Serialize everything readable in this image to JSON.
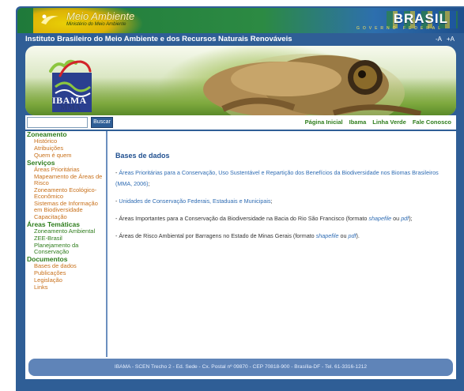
{
  "gov_bar": {
    "title": "Meio Ambiente",
    "subtitle": "Ministério do Meio Ambiente",
    "brasil": "BRASIL",
    "brasil_sub": "GOVERNO FEDERAL"
  },
  "institute": {
    "title": "Instituto Brasileiro do Meio Ambiente e dos Recursos Naturais Renováveis",
    "font_decrease": "-A",
    "font_increase": "+A"
  },
  "banner": {
    "logo_text": "IBAMA",
    "logo_sub": "MMA",
    "colors": {
      "green": "#2e7d1c",
      "blue": "#1f4f8f",
      "orange": "#c8701a"
    }
  },
  "search": {
    "placeholder": "",
    "value": "",
    "button_label": "Buscar"
  },
  "top_nav": [
    "Página Inicial",
    "Ibama",
    "Linha Verde",
    "Fale Conosco"
  ],
  "sidebar": {
    "groups": [
      {
        "title": "Zoneamento",
        "items": [
          "Histórico",
          "Atribuições",
          "Quem é quem"
        ]
      },
      {
        "title": "Serviços",
        "items": [
          "Áreas Prioritárias",
          "Mapeamento de Áreas de Risco",
          "Zoneamento Ecológico-Econômico",
          "Sistemas de Informação em Biodiversidade",
          "Capacitação"
        ]
      },
      {
        "title": "Áreas Temáticas",
        "items": [
          "Zoneamento Ambiental",
          "ZEE-Brasil",
          "Planejamento da Conservação"
        ]
      },
      {
        "title": "Documentos",
        "items": [
          "Bases de dados",
          "Publicações",
          "Legislação",
          "Links"
        ]
      }
    ]
  },
  "main": {
    "heading": "Bases de dados",
    "p1_prefix": "- ",
    "p1_link": "Áreas Prioritárias para a Conservação, Uso Sustentável e Repartição dos Benefícios da Biodiversidade nos Biomas Brasileiros (MMA, 2006)",
    "p1_suffix": ";",
    "p2_prefix": "- ",
    "p2_link": "Unidades de Conservação Federais, Estaduais e Municipais",
    "p2_suffix": ";",
    "p3_text": "- Áreas Importantes para a Conservação da Biodiversidade na Bacia do Rio São Francisco (formato ",
    "p3_link1": "shapefile",
    "p3_mid": " ou ",
    "p3_link2": "pdf",
    "p3_suffix": ");",
    "p4_text": "- Áreas de Risco Ambiental por Barragens no Estado de Minas Gerais (formato ",
    "p4_link1": "shapefile",
    "p4_mid": " ou ",
    "p4_link2": "pdf",
    "p4_suffix": ")."
  },
  "footer": {
    "text": "IBAMA - SCEN Trecho 2 - Ed. Sede - Cx. Postal nº 09870 - CEP 70818-900 - Brasília-DF - Tel. 61-3316-1212"
  }
}
